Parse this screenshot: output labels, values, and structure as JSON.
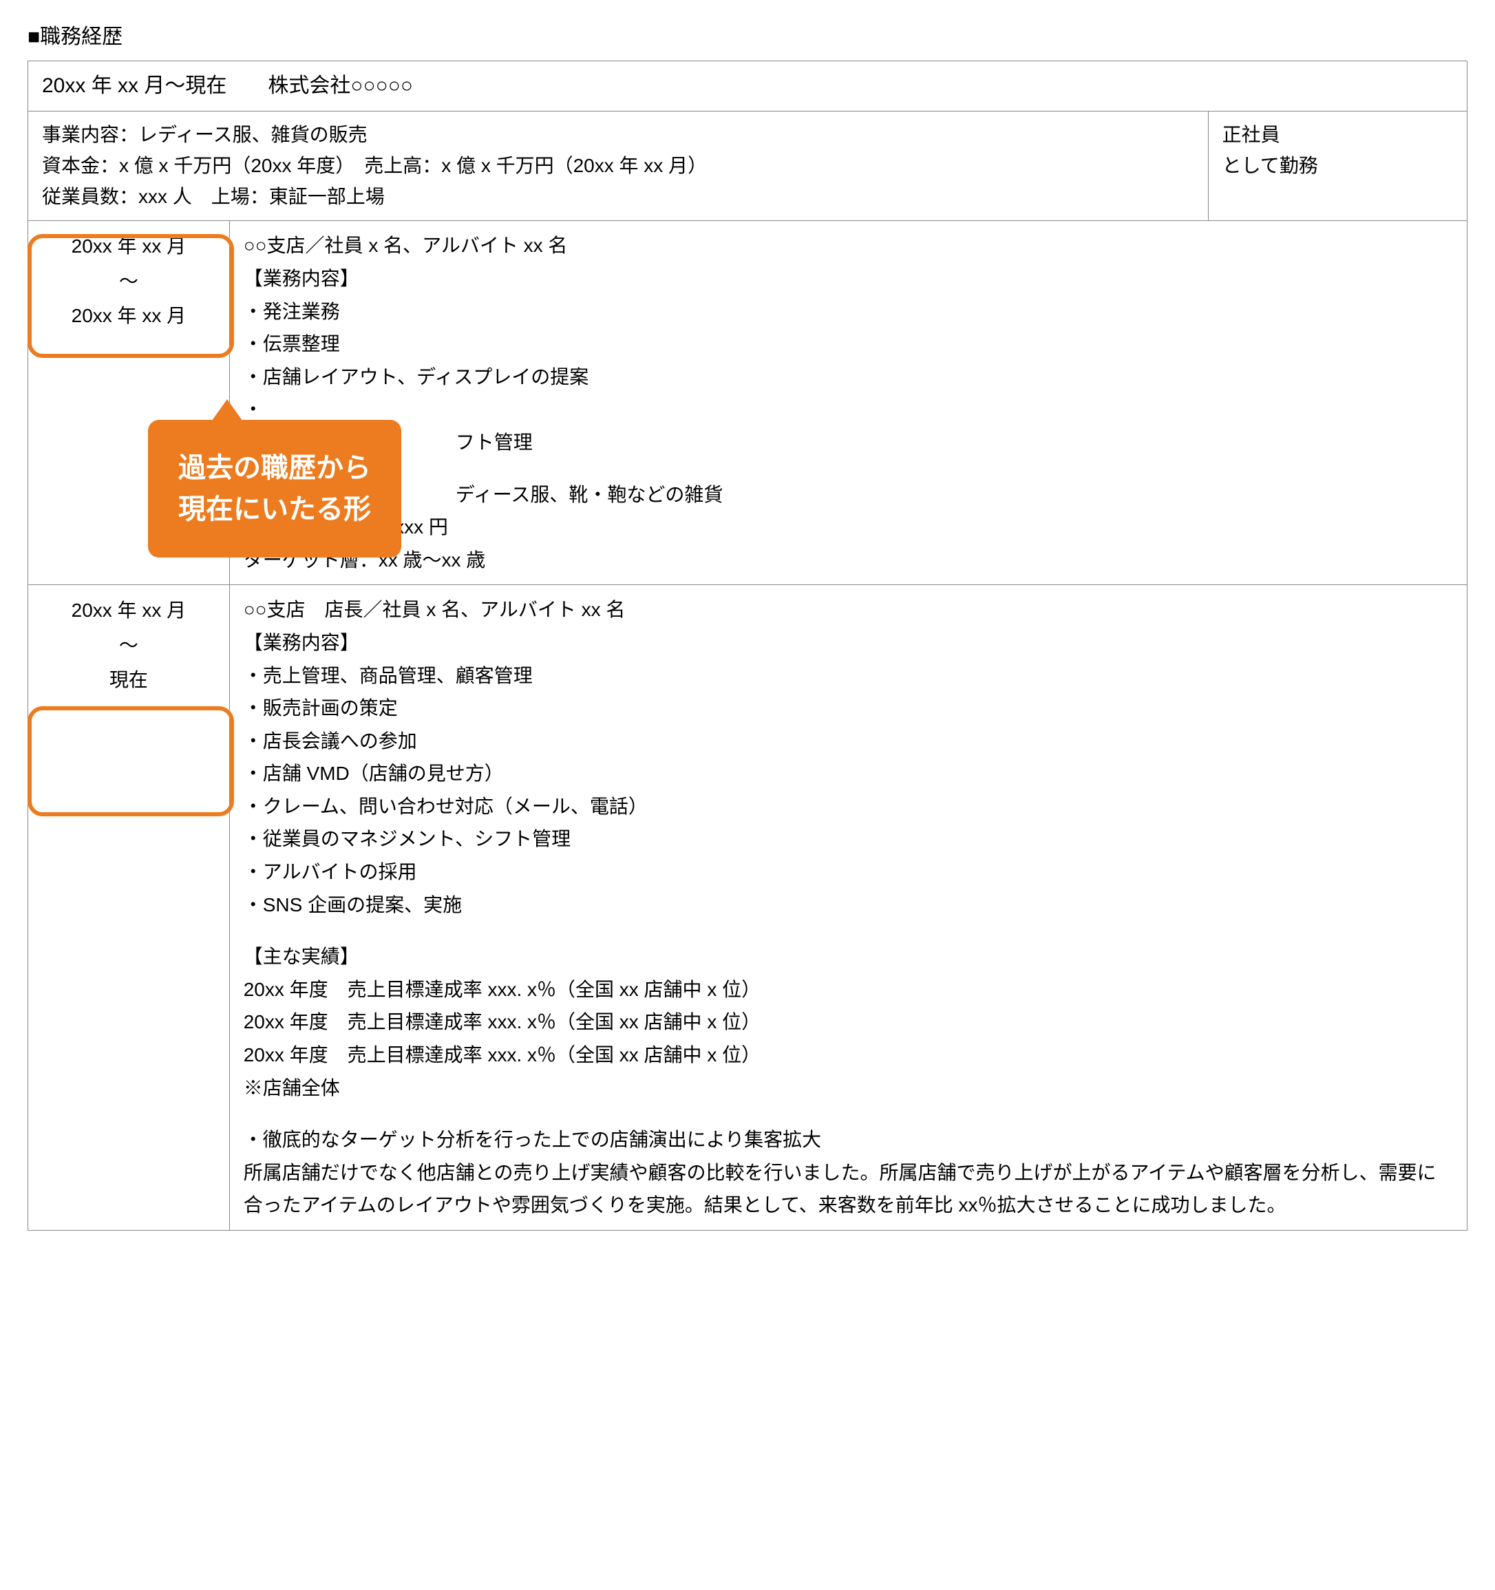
{
  "section_title": "■職務経歴",
  "header": {
    "period_company": "20xx 年 xx 月～現在　　株式会社○○○○○"
  },
  "company_info": {
    "business": "事業内容：レディース服、雑貨の販売",
    "financials": "資本金：x 億 x 千万円（20xx 年度）　売上高：x 億 x 千万円（20xx 年 xx 月）",
    "employees": "従業員数：xxx 人　上場：東証一部上場"
  },
  "employment_status": {
    "line1": "正社員",
    "line2": "として勤務"
  },
  "callout": {
    "line1": "過去の職歴から",
    "line2": "現在にいたる形"
  },
  "period1": {
    "date_start": "20xx 年 xx 月",
    "date_sep": "～",
    "date_end": "20xx 年 xx 月",
    "header": "○○支店／社員 x 名、アルバイト xx 名",
    "duties_label": "【業務内容】",
    "duties": [
      "・発注業務",
      "・伝票整理",
      "・店舗レイアウト、ディスプレイの提案",
      "・",
      "　　　　　　　　　　　フト管理"
    ],
    "store_info": {
      "products": "　　　　　　　　　　　ディース服、靴・鞄などの雑貨",
      "price": "客単価：平均 xx, xxx 円",
      "target": "ターゲット層：xx 歳～xx 歳"
    }
  },
  "period2": {
    "date_start": "20xx 年 xx 月",
    "date_sep": "～",
    "date_end": "現在",
    "header": "○○支店　店長／社員 x 名、アルバイト xx 名",
    "duties_label": "【業務内容】",
    "duties": [
      "・売上管理、商品管理、顧客管理",
      "・販売計画の策定",
      "・店長会議への参加",
      "・店舗 VMD（店舗の見せ方）",
      "・クレーム、問い合わせ対応（メール、電話）",
      "・従業員のマネジメント、シフト管理",
      "・アルバイトの採用",
      "・SNS 企画の提案、実施"
    ],
    "results_label": "【主な実績】",
    "results": [
      "20xx 年度　売上目標達成率 xxx. x％（全国 xx 店舗中 x 位）",
      "20xx 年度　売上目標達成率 xxx. x％（全国 xx 店舗中 x 位）",
      "20xx 年度　売上目標達成率 xxx. x％（全国 xx 店舗中 x 位）",
      "※店舗全体"
    ],
    "achievement_title": "・徹底的なターゲット分析を行った上での店舗演出により集客拡大",
    "achievement_body": "所属店舗だけでなく他店舗との売り上げ実績や顧客の比較を行いました。所属店舗で売り上げが上がるアイテムや顧客層を分析し、需要に合ったアイテムのレイアウトや雰囲気づくりを実施。結果として、来客数を前年比 xx％拡大させることに成功しました。"
  }
}
